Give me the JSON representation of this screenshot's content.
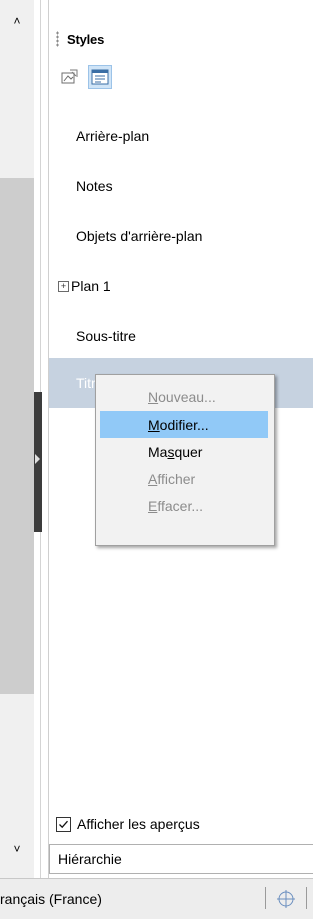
{
  "panel": {
    "title": "Styles",
    "toolbar": [
      {
        "icon": "drawing-styles-icon"
      },
      {
        "icon": "presentation-styles-icon",
        "active": true
      }
    ],
    "styles": [
      {
        "label": "Arrière-plan"
      },
      {
        "label": "Notes"
      },
      {
        "label": "Objets d'arrière-plan"
      },
      {
        "label": "Plan 1",
        "expandable": true
      },
      {
        "label": "Sous-titre"
      },
      {
        "label": "Titre",
        "selected": true
      }
    ],
    "context_menu": {
      "items": [
        {
          "label": "Nouveau...",
          "mnemonic": "N",
          "rest": "ouveau...",
          "enabled": false
        },
        {
          "label": "Modifier...",
          "mnemonic": "M",
          "rest": "odifier...",
          "enabled": true,
          "highlighted": true
        },
        {
          "label": "Masquer",
          "pre": "Ma",
          "mnemonic": "s",
          "rest": "quer",
          "enabled": true
        },
        {
          "label": "Afficher",
          "mnemonic": "A",
          "rest": "fficher",
          "enabled": false
        },
        {
          "label": "Effacer...",
          "mnemonic": "E",
          "rest": "ffacer...",
          "enabled": false
        }
      ]
    },
    "show_previews": {
      "label": "Afficher les aperçus",
      "checked": true
    },
    "filter_select": {
      "value": "Hiérarchie"
    }
  },
  "statusbar": {
    "language": "rançais (France)"
  },
  "colors": {
    "selection": "#c6d2e0",
    "menu_highlight": "#91c9f7",
    "splitter": "#3c3c3c"
  }
}
